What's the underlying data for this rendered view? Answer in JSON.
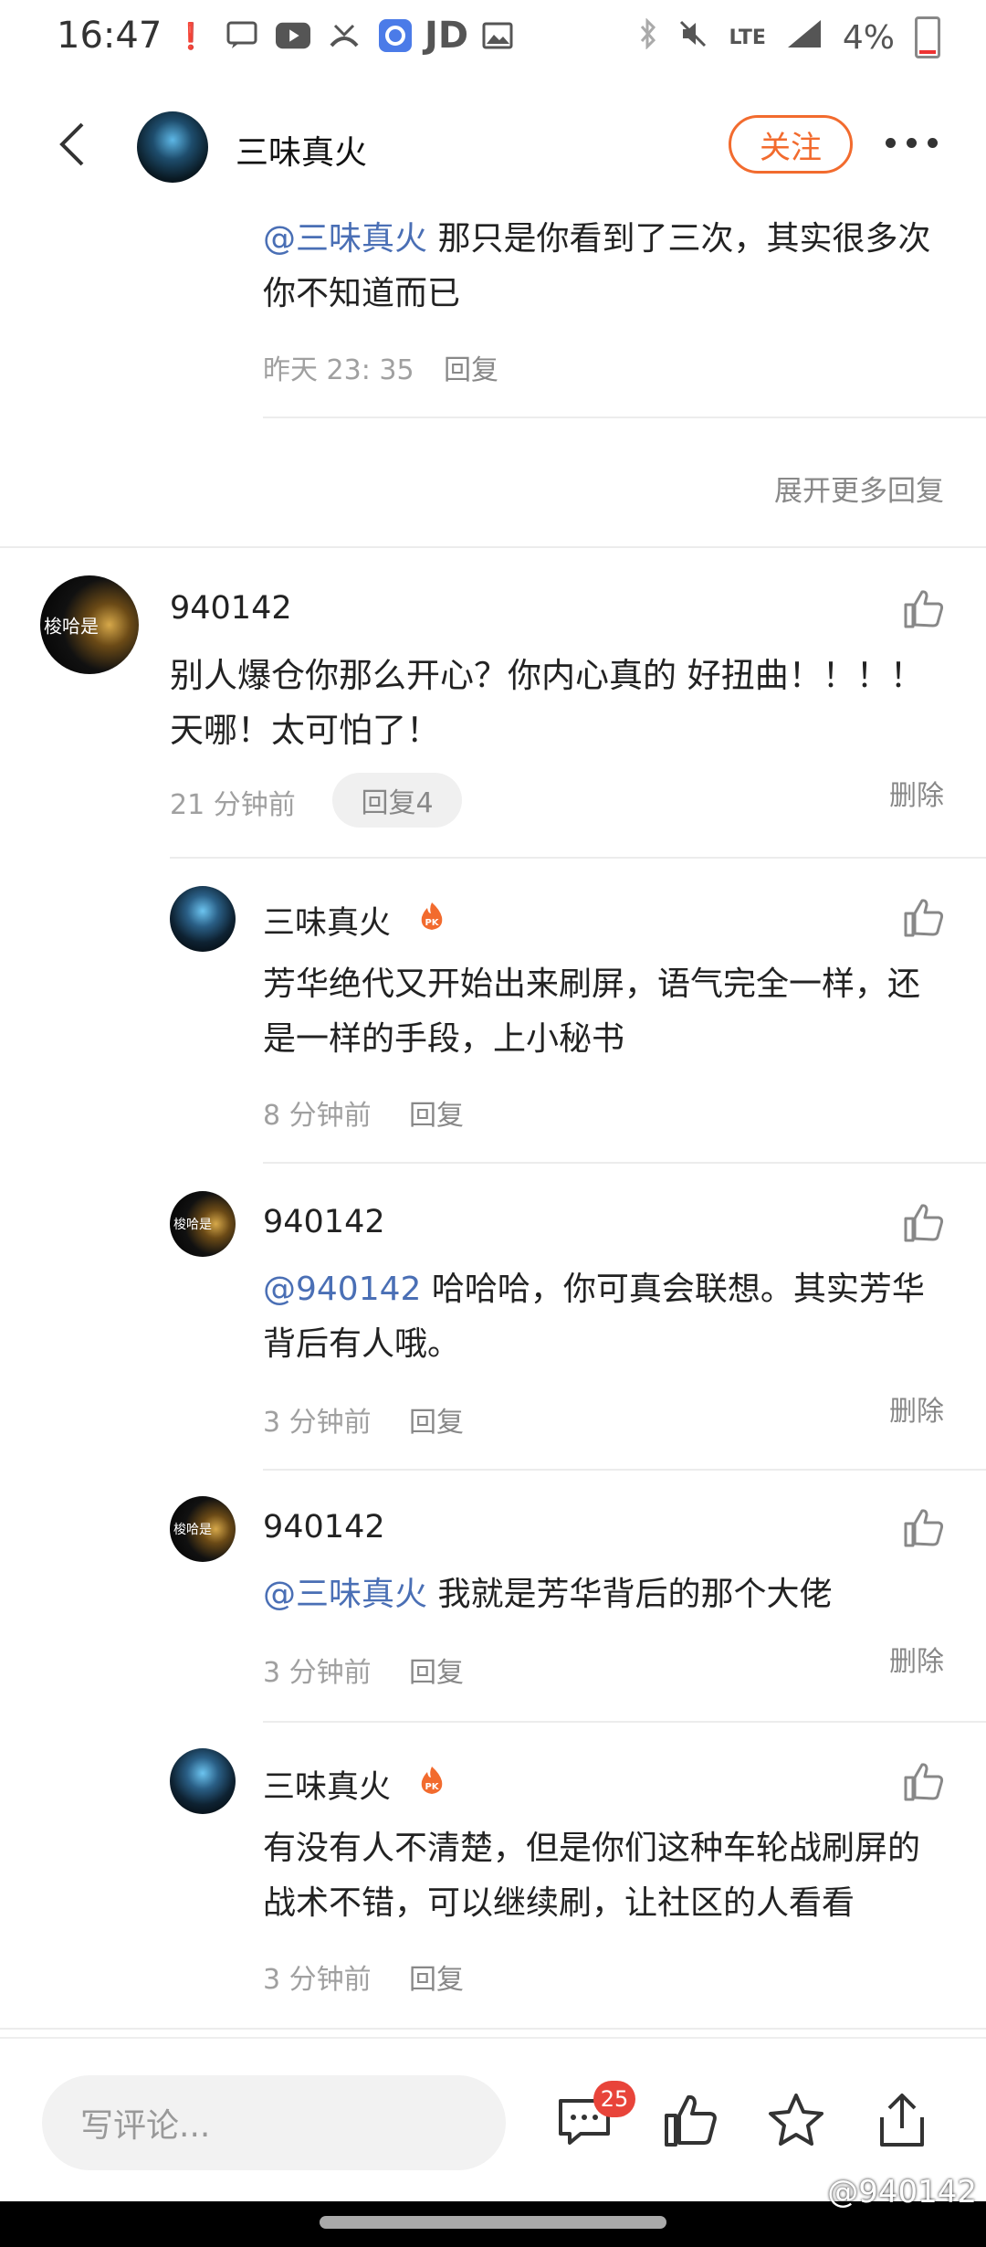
{
  "status_bar": {
    "time": "16:47",
    "jd": "JD",
    "lte": "LTE",
    "battery": "4%"
  },
  "header": {
    "title": "三味真火",
    "follow_label": "关注"
  },
  "top_reply": {
    "mention": "@三味真火",
    "text": " 那只是你看到了三次，其实很多次你不知道而已",
    "time": "昨天 23: 35",
    "reply_label": "回复",
    "expand_label": "展开更多回复"
  },
  "comment": {
    "avatar_text": "梭哈是",
    "username": "940142",
    "text": "别人爆仓你那么开心？你内心真的 好扭曲！！！！天哪！太可怕了！",
    "time": "21 分钟前",
    "replies_pill": "回复4",
    "delete_label": "删除"
  },
  "replies": [
    {
      "username": "三味真火",
      "mention": "",
      "text": "芳华绝代又开始出来刷屏，语气完全一样，还是一样的手段，上小秘书",
      "time": "8 分钟前",
      "reply_label": "回复",
      "delete_label": ""
    },
    {
      "username": "940142",
      "mention": "@940142",
      "text": " 哈哈哈，你可真会联想。其实芳华背后有人哦。",
      "time": "3 分钟前",
      "reply_label": "回复",
      "delete_label": "删除"
    },
    {
      "username": "940142",
      "mention": "@三味真火",
      "text": " 我就是芳华背后的那个大佬",
      "time": "3 分钟前",
      "reply_label": "回复",
      "delete_label": "删除"
    },
    {
      "username": "三味真火",
      "mention": "",
      "text": "有没有人不清楚，但是你们这种车轮战刷屏的战术不错，可以继续刷，让社区的人看看",
      "time": "3 分钟前",
      "reply_label": "回复",
      "delete_label": ""
    }
  ],
  "bottom_bar": {
    "input_placeholder": "写评论...",
    "comment_count": "25"
  },
  "watermark": "@940142",
  "colors": {
    "accent": "#f26b2e",
    "mention": "#4a6fb5",
    "badge": "#e8443a"
  }
}
